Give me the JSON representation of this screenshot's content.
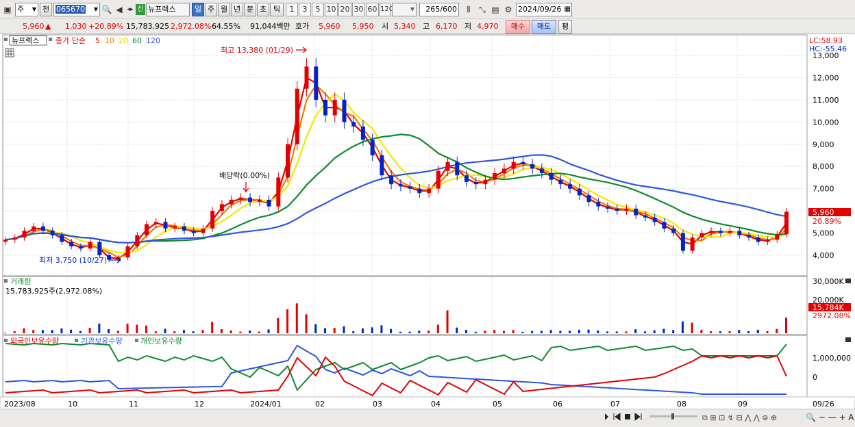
{
  "toolbar": {
    "market_select": "주",
    "prev_label": "전",
    "code": "065670",
    "sector_badge": "신",
    "stock_name": "뉴프렉스",
    "period_tabs": [
      "일",
      "주",
      "월",
      "년",
      "분",
      "초",
      "틱"
    ],
    "active_period": "일",
    "num_tabs": [
      "1",
      "3",
      "5",
      "10",
      "20",
      "30",
      "60",
      "120"
    ],
    "count_current": "265",
    "count_total": "/600",
    "date": "2024/09/26"
  },
  "quote": {
    "price": "5,960",
    "arrow": "▲",
    "change": "1,030",
    "change_pct": "+20.89%",
    "volume": "15,783,925",
    "volume_ratio": "2,972.08%",
    "turnover": "64.55%",
    "amount": "91,044백만",
    "hoga_label": "호가",
    "ask": "5,960",
    "bid": "5,950",
    "open_label": "시",
    "open": "5,340",
    "high_label": "고",
    "high": "6,170",
    "low_label": "저",
    "low": "4,970",
    "buy_label": "매수",
    "sell_label": "매도",
    "eval_label": "평"
  },
  "price_panel": {
    "stock_tag": "뉴프렉스",
    "ma_label": "종가 단순",
    "ma_periods": [
      "5",
      "10",
      "20",
      "60",
      "120"
    ],
    "lc": "LC:58.93",
    "hc": "HC:-55.46",
    "high_annot": "최고 13,380 (01/29)",
    "low_annot": "최저 3,750 (10/27)",
    "div_annot": "배당락(0.00%)",
    "price_box": "5,960",
    "pct_box": "20.89%",
    "y_ticks": [
      "13,000",
      "12,000",
      "11,000",
      "10,000",
      "9,000",
      "8,000",
      "7,000",
      "6,000",
      "5,000",
      "4,000"
    ]
  },
  "volume_panel": {
    "title": "거래량",
    "info": "15,783,925주(2,972.08%)",
    "y_ticks": [
      "30,000K",
      "20,000K"
    ],
    "box": "15,784K",
    "pct": "2972.08%"
  },
  "holdings_panel": {
    "legend": [
      "외국인보유수량",
      "기관보유수량",
      "개인보유수량"
    ],
    "y_ticks": [
      "1,000,000",
      "0"
    ]
  },
  "x_labels": [
    "2023/08",
    "10",
    "11",
    "12",
    "2024/01",
    "02",
    "03",
    "04",
    "05",
    "06",
    "07",
    "08",
    "09",
    "09/26"
  ],
  "colors": {
    "up": "#e30000",
    "down": "#0025c8",
    "ma5": "#e30000",
    "ma10": "#f07a00",
    "ma20": "#f5e600",
    "ma60": "#0f8a2a",
    "ma120": "#2d56e0"
  },
  "chart_data": {
    "type": "line",
    "title": "뉴프렉스",
    "series": [
      {
        "name": "종가",
        "values": [
          4700,
          4800,
          5100,
          5300,
          5100,
          4900,
          4600,
          4400,
          4300,
          4600,
          4000,
          3800,
          3900,
          4400,
          4900,
          5400,
          5500,
          5200,
          5300,
          5100,
          5000,
          5200,
          6000,
          6300,
          6500,
          6600,
          6400,
          6500,
          6200,
          7500,
          9000,
          11500,
          12500,
          11000,
          10300,
          11000,
          10000,
          9800,
          9200,
          8500,
          7600,
          7200,
          7100,
          7000,
          6800,
          7000,
          7800,
          8200,
          7600,
          7300,
          7200,
          7400,
          7700,
          7900,
          8200,
          8100,
          7900,
          7700,
          7400,
          7200,
          7000,
          6700,
          6400,
          6200,
          6100,
          6000,
          6100,
          5800,
          5700,
          5500,
          5200,
          5000,
          4200,
          4800,
          5000,
          5100,
          5000,
          5100,
          4900,
          4800,
          4600,
          4700,
          4950,
          5960
        ]
      }
    ]
  }
}
